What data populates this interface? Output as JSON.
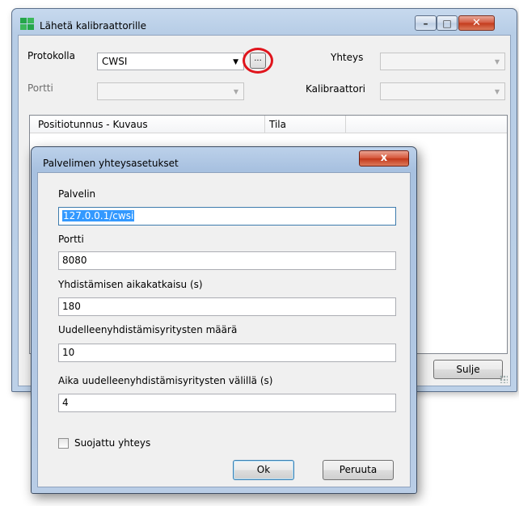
{
  "main_window": {
    "title": "Lähetä kalibraattorille",
    "protocol_label": "Protokolla",
    "protocol_value": "CWSI",
    "dots_label": "...",
    "port_label": "Portti",
    "connection_label": "Yhteys",
    "calibrator_label": "Kalibraattori",
    "grid": {
      "columns": [
        "Positiotunnus - Kuvaus",
        "Tila"
      ]
    },
    "close_label": "Sulje"
  },
  "dialog": {
    "title": "Palvelimen yhteysasetukset",
    "close_glyph": "x",
    "fields": [
      {
        "label": "Palvelin",
        "value": "127.0.0.1/cwsi"
      },
      {
        "label": "Portti",
        "value": "8080"
      },
      {
        "label": "Yhdistämisen aikakatkaisu (s)",
        "value": "180"
      },
      {
        "label": "Uudelleenyhdistämisyritysten määrä",
        "value": "10"
      },
      {
        "label": "Aika uudelleenyhdistämisyritysten välillä (s)",
        "value": "4"
      }
    ],
    "secure_label": "Suojattu yhteys",
    "ok_label": "Ok",
    "cancel_label": "Peruuta"
  },
  "colors": {
    "highlight_ring": "#e0151d",
    "selection": "#3399ff"
  },
  "icons": [
    "app-icon",
    "minimize-icon",
    "maximize-icon",
    "close-icon",
    "chevron-down-icon",
    "resize-grip-icon"
  ]
}
